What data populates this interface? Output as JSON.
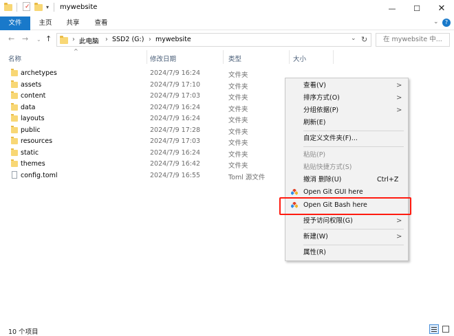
{
  "window": {
    "title": "mywebsite"
  },
  "ribbon": {
    "tabs": [
      "文件",
      "主页",
      "共享",
      "查看"
    ]
  },
  "address": {
    "path": [
      "此电脑",
      "SSD2 (G:)",
      "mywebsite"
    ],
    "search_placeholder": "在 mywebsite 中..."
  },
  "columns": {
    "name": "名称",
    "date": "修改日期",
    "type": "类型",
    "size": "大小"
  },
  "files": [
    {
      "name": "archetypes",
      "date": "2024/7/9 16:24",
      "type": "文件夹",
      "icon": "folder-icon"
    },
    {
      "name": "assets",
      "date": "2024/7/9 17:10",
      "type": "文件夹",
      "icon": "folder-icon"
    },
    {
      "name": "content",
      "date": "2024/7/9 17:03",
      "type": "文件夹",
      "icon": "folder-icon"
    },
    {
      "name": "data",
      "date": "2024/7/9 16:24",
      "type": "文件夹",
      "icon": "folder-icon"
    },
    {
      "name": "layouts",
      "date": "2024/7/9 16:24",
      "type": "文件夹",
      "icon": "folder-icon"
    },
    {
      "name": "public",
      "date": "2024/7/9 17:28",
      "type": "文件夹",
      "icon": "folder-icon"
    },
    {
      "name": "resources",
      "date": "2024/7/9 17:03",
      "type": "文件夹",
      "icon": "folder-icon"
    },
    {
      "name": "static",
      "date": "2024/7/9 16:24",
      "type": "文件夹",
      "icon": "folder-icon"
    },
    {
      "name": "themes",
      "date": "2024/7/9 16:42",
      "type": "文件夹",
      "icon": "folder-icon"
    },
    {
      "name": "config.toml",
      "date": "2024/7/9 16:55",
      "type": "Toml 源文件",
      "icon": "document-icon"
    }
  ],
  "status": {
    "item_count": "10 个项目"
  },
  "context_menu": {
    "view": "查看(V)",
    "sort": "排序方式(O)",
    "group": "分组依据(P)",
    "refresh": "刷新(E)",
    "customize": "自定义文件夹(F)...",
    "paste": "粘贴(P)",
    "paste_shortcut": "粘贴快捷方式(S)",
    "undo": "撤消 删除(U)",
    "undo_shortcut": "Ctrl+Z",
    "git_gui": "Open Git GUI here",
    "git_bash": "Open Git Bash here",
    "give_access": "授予访问权限(G)",
    "new": "新建(W)",
    "properties": "属性(R)"
  },
  "colors": {
    "accent": "#1979ca",
    "highlight": "#ff1a0f",
    "folder": "#f8d775"
  }
}
